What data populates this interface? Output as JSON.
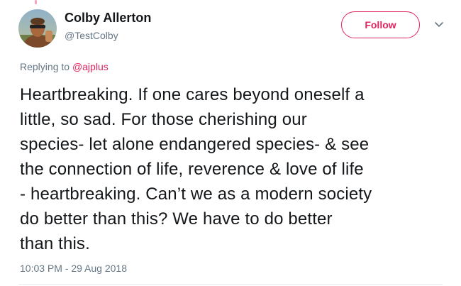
{
  "author": {
    "name": "Colby Allerton",
    "handle": "@TestColby"
  },
  "follow_label": "Follow",
  "reply": {
    "prefix": "Replying to",
    "handle": "@ajplus"
  },
  "tweet_text": "Heartbreaking. If one cares beyond oneself a\nlittle, so sad. For those cherishing our\nspecies- let alone endangered species- & see\nthe connection of life, reverence & love of life\n- heartbreaking. Can’t we as a modern society\ndo better than this? We have to do better\nthan this.",
  "timestamp": "10:03 PM - 29 Aug 2018",
  "colors": {
    "accent": "#e0245e",
    "text": "#14171a",
    "secondary": "#657786",
    "divider": "#e6ecf0"
  },
  "icons": {
    "more": "chevron-down-icon"
  }
}
